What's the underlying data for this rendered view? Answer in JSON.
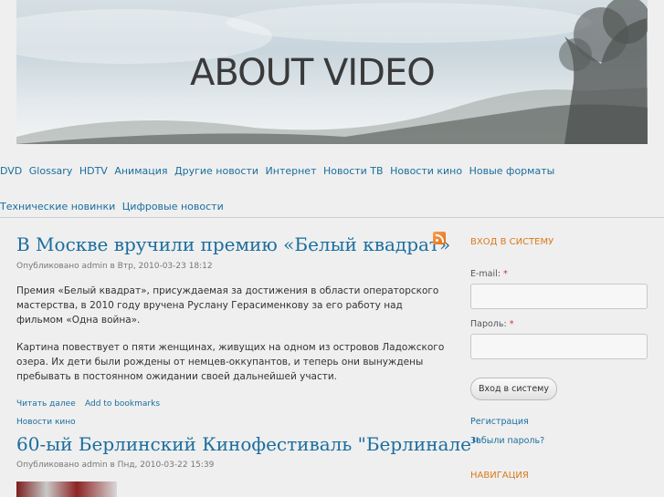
{
  "header": {
    "site_title": "ABOUT VIDEO"
  },
  "nav": {
    "items": [
      "DVD",
      "Glossary",
      "HDTV",
      "Анимация",
      "Другие новости",
      "Интернет",
      "Новости ТВ",
      "Новости кино",
      "Новые форматы",
      "Технические новинки",
      "Цифровые новости"
    ]
  },
  "posts": [
    {
      "title": "В Москве вручили премию «Белый квадрат»",
      "meta": "Опубликовано admin в Втр, 2010-03-23 18:12",
      "paragraphs": [
        "Премия «Белый квадрат», присуждаемая за достижения в области операторского мастерства, в 2010 году вручена Руслану Герасименкову за его работу над фильмом «Одна война».",
        "Картина повествует о пяти женщинах, живущих на одном из островов Ладожского озера. Их дети были рождены от немцев-оккупантов, и теперь они вынуждены пребывать в постоянном ожидании своей дальнейшей участи."
      ],
      "read_more": "Читать далее",
      "bookmark": "Add to bookmarks",
      "category": "Новости кино"
    },
    {
      "title": "60-ый Берлинский Кинофестиваль \"Берлинале\"",
      "meta": "Опубликовано admin в Пнд, 2010-03-22 15:39"
    }
  ],
  "sidebar": {
    "login_heading": "Вход в систему",
    "email_label": "E-mail:",
    "password_label": "Пароль:",
    "required_mark": "*",
    "login_button": "Вход в систему",
    "register_link": "Регистрация",
    "forgot_link": "Забыли пароль?",
    "navigation_heading": "Навигация"
  }
}
